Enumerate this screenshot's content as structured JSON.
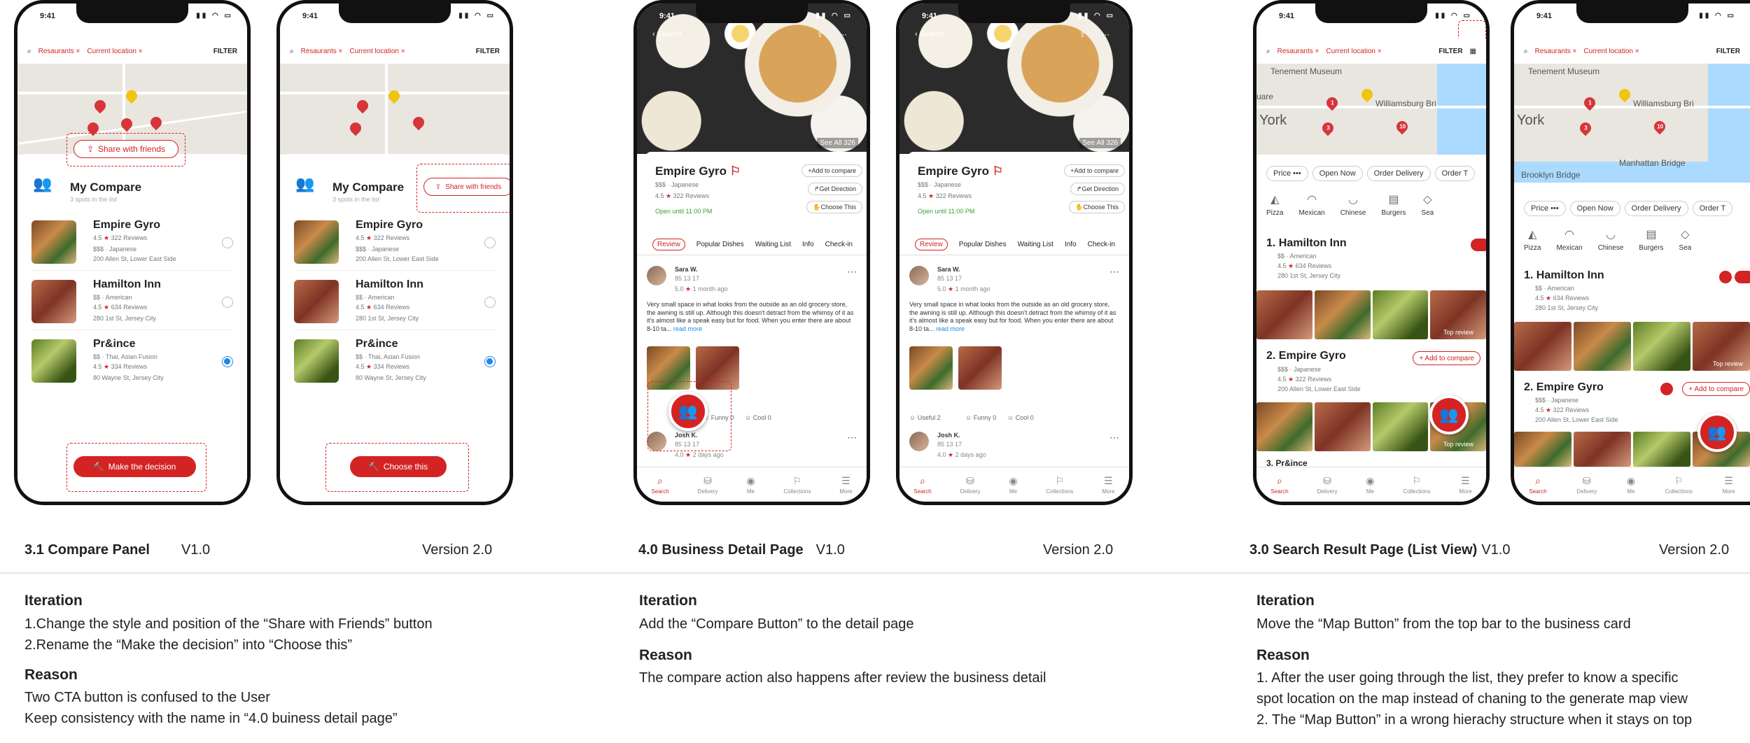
{
  "status_time": "9:41",
  "phones": {
    "compare": {
      "chips": [
        "Resaurants",
        "Current location"
      ],
      "filter": "FILTER",
      "share_label": "Share with friends",
      "title": "My Compare",
      "subtitle": "3 spots in the list",
      "items": [
        {
          "name": "Empire Gyro",
          "rating": "4.5",
          "reviews": "322 Reviews",
          "meta": "$$$ · Japanese",
          "address": "200 Allen St, Lower East Side"
        },
        {
          "name": "Hamilton Inn",
          "rating": "4.5",
          "reviews": "634 Reviews",
          "meta": "$$ · American",
          "address": "280 1st St, Jersey City"
        },
        {
          "name": "Pr&ince",
          "rating": "4.5",
          "reviews": "334 Reviews",
          "meta": "$$ · Thai, Asian Fusion",
          "address": "80 Wayne St, Jersey City"
        }
      ],
      "v1_cta": "Make the decision",
      "v2_cta": "Choose this"
    },
    "detail": {
      "back": "Search",
      "see_all": "See All 326",
      "name": "Empire Gyro",
      "meta": "$$$ · Japanese",
      "rating": "4.5",
      "reviews": "322 Reviews",
      "open": "Open until 11:00 PM",
      "actions": [
        "Add to compare",
        "Get Direction",
        "Choose This"
      ],
      "tabs": [
        "Review",
        "Popular Dishes",
        "Waiting List",
        "Info",
        "Check-in"
      ],
      "review1": {
        "user": "Sara W.",
        "stats": "85  13  17",
        "rating": "5.0",
        "time": "1 month ago",
        "text": "Very small space in what looks from the outside as an old grocery store, the awning is still up. Although this doesn't detract from the whimsy of it as it's almost like a speak easy but for food. When you enter there are about 8-10 ta...",
        "read_more": "read more"
      },
      "reactions": [
        "Useful 2",
        "Funny 0",
        "Cool 0"
      ],
      "review2": {
        "user": "Josh K.",
        "stats": "85  13  17",
        "rating": "4.0",
        "time": "2 days ago"
      }
    },
    "search": {
      "chips": [
        "Resaurants",
        "Current location"
      ],
      "filter": "FILTER",
      "map_labels": [
        "Tenement Museum",
        "Williamsburg Bri",
        "York",
        "uare",
        "Manhattan Bridge",
        "Brooklyn Bridge"
      ],
      "filters": [
        "Price",
        "Open Now",
        "Order Delivery",
        "Order T"
      ],
      "cats": [
        "Pizza",
        "Mexican",
        "Chinese",
        "Burgers",
        "Sea"
      ],
      "results": [
        {
          "name": "1. Hamilton Inn",
          "meta": "$$ · American",
          "rating": "4.5",
          "reviews": "634 Reviews",
          "address": "280 1st St, Jersey City"
        },
        {
          "name": "2. Empire Gyro",
          "meta": "$$$ · Japanese",
          "rating": "4.5",
          "reviews": "322 Reviews",
          "address": "200 Allen St, Lower East Side"
        }
      ],
      "third": "3. Pr&ince",
      "add_compare": "+ Add to compare",
      "top_review": "Top review"
    },
    "tabbar": [
      "Search",
      "Delivery",
      "Me",
      "Collections",
      "More"
    ]
  },
  "captions": {
    "compare": {
      "title": "3.1 Compare Panel",
      "v1": "V1.0",
      "v2": "Version 2.0"
    },
    "detail": {
      "title": "4.0 Business Detail Page",
      "v1": "V1.0",
      "v2": "Version 2.0"
    },
    "search": {
      "title": "3.0 Search Result Page (List View)",
      "v1": "V1.0",
      "v2": "Version 2.0"
    }
  },
  "notes": {
    "compare": {
      "iteration_h": "Iteration",
      "iteration": [
        "1.Change the style and position of the “Share with Friends” button",
        "2.Rename the “Make the decision” into “Choose this”"
      ],
      "reason_h": "Reason",
      "reason": [
        "Two CTA button is confused to the User",
        "Keep consistency with the name in “4.0 buiness detail page”"
      ]
    },
    "detail": {
      "iteration_h": "Iteration",
      "iteration": [
        "Add the “Compare Button” to the detail page"
      ],
      "reason_h": "Reason",
      "reason": [
        "The compare action also happens after review the business detail"
      ]
    },
    "search": {
      "iteration_h": "Iteration",
      "iteration": [
        "Move the “Map Button” from the top bar to the business card"
      ],
      "reason_h": "Reason",
      "reason": [
        "1. After the user going through the list, they prefer to know a specific",
        "spot location on the map instead of chaning to the generate map view",
        "2. The “Map Button” in a wrong hierachy structure when it stays on top"
      ]
    }
  },
  "colors": {
    "accent": "#d32323",
    "radio_on": "#1e88e5"
  }
}
